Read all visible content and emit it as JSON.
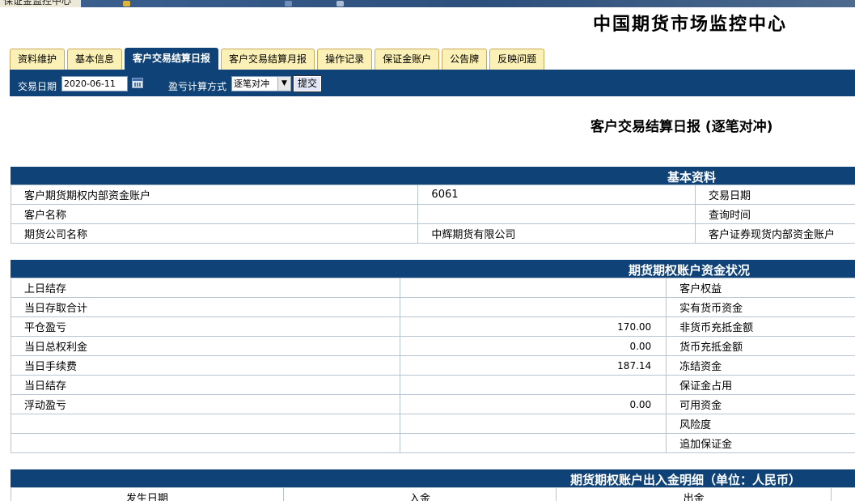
{
  "window": {
    "title": "保证金监控中心"
  },
  "header": {
    "brand": "中国期货市场监控中心"
  },
  "tabs": [
    {
      "label": "资料维护"
    },
    {
      "label": "基本信息"
    },
    {
      "label": "客户交易结算日报",
      "active": true
    },
    {
      "label": "客户交易结算月报"
    },
    {
      "label": "操作记录"
    },
    {
      "label": "保证金账户"
    },
    {
      "label": "公告牌"
    },
    {
      "label": "反映问题"
    }
  ],
  "query": {
    "date_label": "交易日期",
    "date_value": "2020-06-11",
    "method_label": "盈亏计算方式",
    "method_value": "逐笔对冲",
    "submit_label": "提交"
  },
  "report": {
    "title": "客户交易结算日报 (逐笔对冲)"
  },
  "basic_info": {
    "header": "基本资料",
    "rows": [
      {
        "label": "客户期货期权内部资金账户",
        "value": "6061",
        "right_label": "交易日期"
      },
      {
        "label": "客户名称",
        "value": "",
        "right_label": "查询时间"
      },
      {
        "label": "期货公司名称",
        "value": "中辉期货有限公司",
        "right_label": "客户证券现货内部资金账户"
      }
    ]
  },
  "fund_status": {
    "header": "期货期权账户资金状况",
    "rows": [
      {
        "label": "上日结存",
        "value": "",
        "right_label": "客户权益"
      },
      {
        "label": "当日存取合计",
        "value": "",
        "right_label": "实有货币资金"
      },
      {
        "label": "平仓盈亏",
        "value": "170.00",
        "right_label": "非货币充抵金额"
      },
      {
        "label": "当日总权利金",
        "value": "0.00",
        "right_label": "货币充抵金额"
      },
      {
        "label": "当日手续费",
        "value": "187.14",
        "right_label": "冻结资金"
      },
      {
        "label": "当日结存",
        "value": "",
        "right_label": "保证金占用"
      },
      {
        "label": "浮动盈亏",
        "value": "0.00",
        "right_label": "可用资金"
      },
      {
        "label": "",
        "value": "",
        "right_label": "风险度"
      },
      {
        "label": "",
        "value": "",
        "right_label": "追加保证金"
      }
    ]
  },
  "cash_flow": {
    "header": "期货期权账户出入金明细（单位：人民币）",
    "columns": [
      "发生日期",
      "入金",
      "出金"
    ]
  }
}
